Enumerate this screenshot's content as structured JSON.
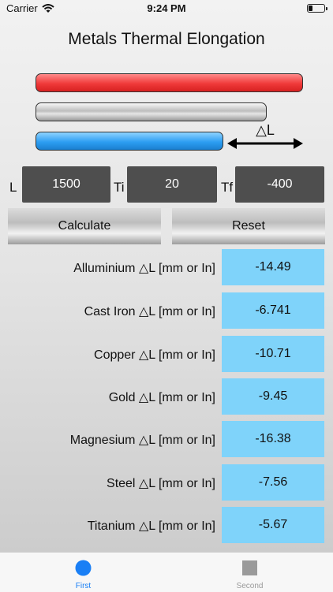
{
  "status_bar": {
    "carrier": "Carrier",
    "time": "9:24 PM"
  },
  "app": {
    "title": "Metals Thermal Elongation"
  },
  "diagram": {
    "delta_label": "△L"
  },
  "inputs": {
    "length": {
      "label": "L",
      "value": "1500"
    },
    "initial_temp": {
      "label": "Ti",
      "value": "20"
    },
    "final_temp": {
      "label": "Tf",
      "value": "-400"
    }
  },
  "buttons": {
    "calculate": "Calculate",
    "reset": "Reset"
  },
  "results": [
    {
      "label": "Alluminium △L [mm or In]",
      "value": "-14.49"
    },
    {
      "label": "Cast Iron △L [mm or In]",
      "value": "-6.741"
    },
    {
      "label": "Copper △L [mm or In]",
      "value": "-10.71"
    },
    {
      "label": "Gold △L [mm or In]",
      "value": "-9.45"
    },
    {
      "label": "Magnesium △L [mm or In]",
      "value": "-16.38"
    },
    {
      "label": "Steel △L [mm or In]",
      "value": "-7.56"
    },
    {
      "label": "Titanium △L [mm or In]",
      "value": "-5.67"
    }
  ],
  "tabs": [
    {
      "label": "First",
      "icon": "circle-icon",
      "active": true,
      "color": "#1a7ff5"
    },
    {
      "label": "Second",
      "icon": "square-icon",
      "active": false,
      "color": "#9a9a9a"
    }
  ],
  "colors": {
    "result_bg": "#7fd3fa",
    "input_bg": "#4e4e4e",
    "accent": "#1a7ff5"
  }
}
